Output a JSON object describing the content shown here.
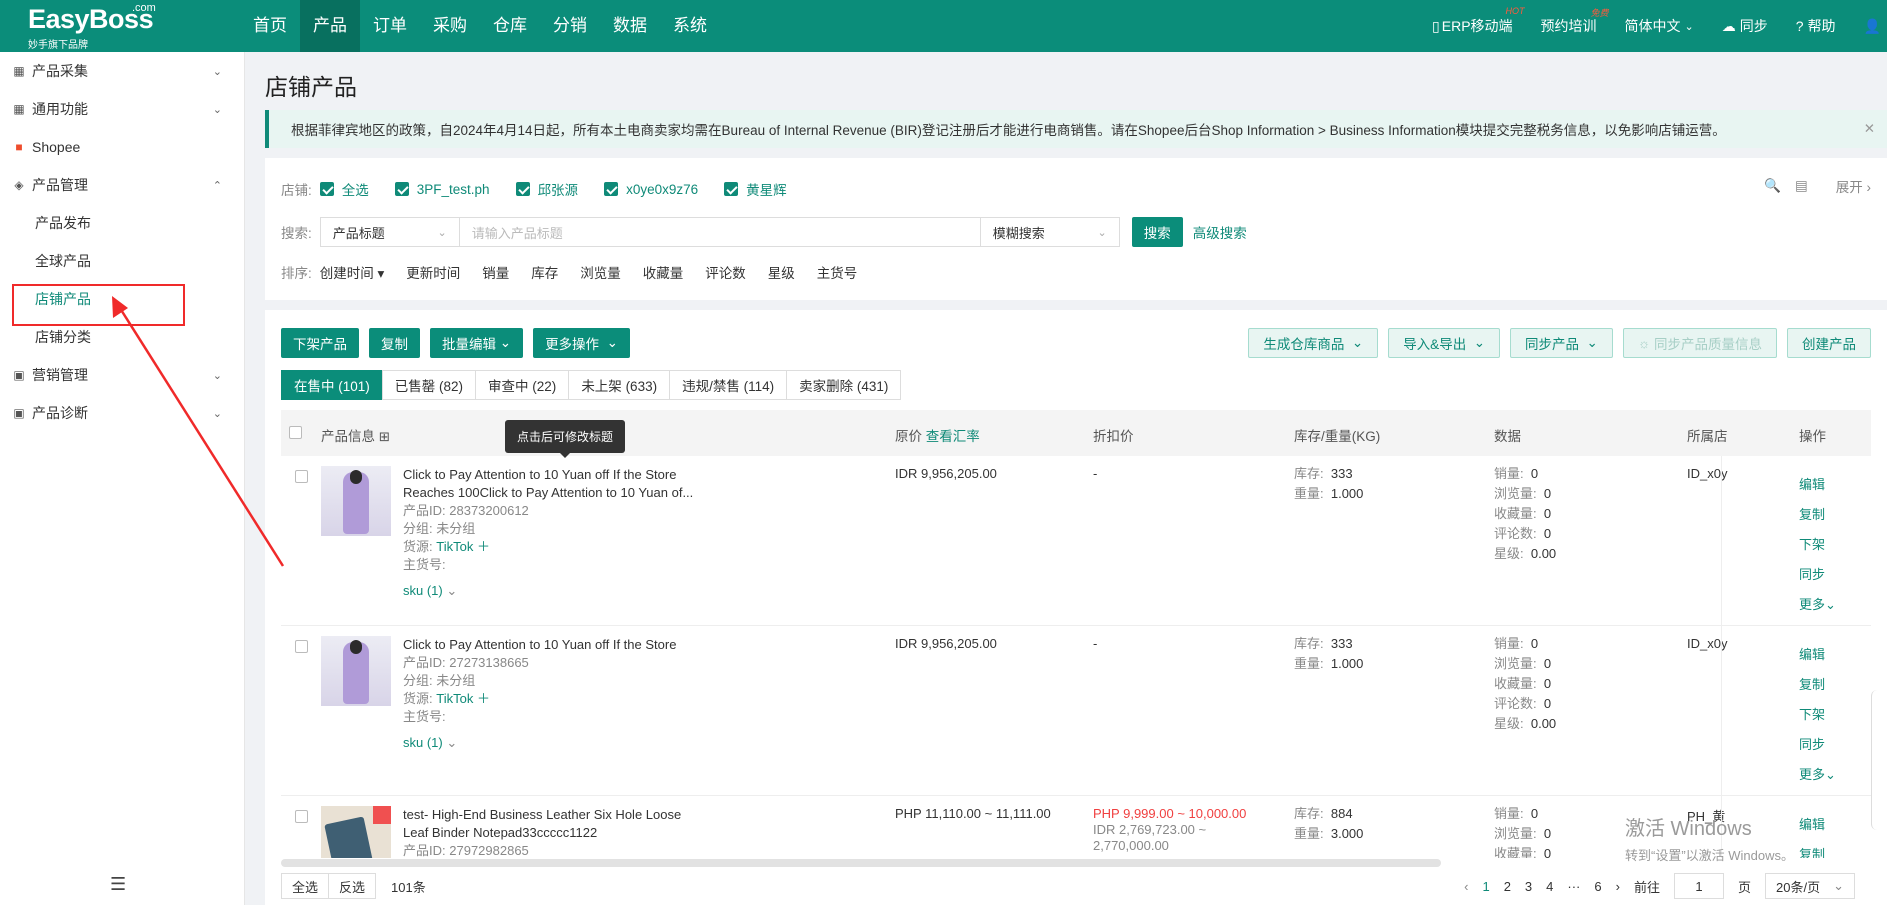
{
  "topbar": {
    "brand": "EasyBoss",
    "brand_suffix": ".com",
    "slogan": "妙手旗下品牌",
    "nav": [
      "首页",
      "产品",
      "订单",
      "采购",
      "仓库",
      "分销",
      "数据",
      "系统"
    ],
    "right": {
      "mobile": "ERP移动端",
      "mobile_badge": "HOT",
      "training": "预约培训",
      "training_badge": "免费",
      "language": "简体中文",
      "sync": "同步",
      "help": "帮助"
    }
  },
  "sidebar": {
    "groups": [
      {
        "label": "产品采集",
        "icon": "grid-icon"
      },
      {
        "label": "通用功能",
        "icon": "grid-icon"
      },
      {
        "label": "Shopee",
        "icon": "shopee-bag-icon"
      },
      {
        "label": "产品管理",
        "icon": "cube-icon"
      }
    ],
    "sub_items": [
      "产品发布",
      "全球产品",
      "店铺产品",
      "店铺分类"
    ],
    "active_sub": "店铺产品",
    "more_groups": [
      {
        "label": "营销管理",
        "icon": "megaphone-icon"
      },
      {
        "label": "产品诊断",
        "icon": "diagnosis-icon"
      }
    ]
  },
  "page": {
    "title": "店铺产品",
    "notice": "根据菲律宾地区的政策，自2024年4月14日起，所有本土电商卖家均需在Bureau of Internal Revenue (BIR)登记注册后才能进行电商销售。请在Shopee后台Shop Information > Business Information模块提交完整税务信息，以免影响店铺运营。"
  },
  "filter": {
    "shop_label": "店铺:",
    "shops": [
      "全选",
      "3PF_test.ph",
      "邱张源",
      "x0ye0x9z76",
      "黄星辉"
    ],
    "expand": "展开",
    "search_label": "搜索:",
    "search_field": "产品标题",
    "search_placeholder": "请输入产品标题",
    "match_mode": "模糊搜索",
    "search_btn": "搜索",
    "advanced": "高级搜索",
    "sort_label": "排序:",
    "sort_active": "创建时间",
    "sorts": [
      "更新时间",
      "销量",
      "库存",
      "浏览量",
      "收藏量",
      "评论数",
      "星级",
      "主货号"
    ]
  },
  "actions": {
    "left": [
      "下架产品",
      "复制",
      "批量编辑",
      "更多操作"
    ],
    "right": [
      "生成仓库商品",
      "导入&导出",
      "同步产品",
      "同步产品质量信息",
      "创建产品"
    ]
  },
  "tabs": [
    "在售中 (101)",
    "已售罄 (82)",
    "审查中 (22)",
    "未上架 (633)",
    "违规/禁售 (114)",
    "卖家删除 (431)"
  ],
  "table": {
    "headers": {
      "info": "产品信息",
      "price": "原价",
      "rate": "查看汇率",
      "discount": "折扣价",
      "stock": "库存/重量(KG)",
      "data": "数据",
      "store": "所属店",
      "op": "操作"
    },
    "tooltip": "点击后可修改标题",
    "labels": {
      "id": "产品ID:",
      "group": "分组:",
      "source": "货源:",
      "sku_no": "主货号:",
      "stock": "库存:",
      "weight": "重量:",
      "sales": "销量:",
      "views": "浏览量:",
      "favs": "收藏量:",
      "reviews": "评论数:",
      "stars": "星级:"
    },
    "ops": [
      "编辑",
      "复制",
      "下架",
      "同步",
      "更多"
    ],
    "rows": [
      {
        "title1": "Click to Pay Attention to 10 Yuan off If the Store",
        "title2": "Reaches 100Click to Pay Attention to 10 Yuan of...",
        "id": "28373200612",
        "group": "未分组",
        "source": "TikTok",
        "sku": "sku (1)",
        "price": "IDR 9,956,205.00",
        "discount": "-",
        "stock": "333",
        "weight": "1.000",
        "sales": "0",
        "views": "0",
        "favs": "0",
        "reviews": "0",
        "stars": "0.00",
        "store": "ID_x0y"
      },
      {
        "title1": "Click to Pay Attention to 10 Yuan off If the Store",
        "title2": "",
        "id": "27273138665",
        "group": "未分组",
        "source": "TikTok",
        "sku": "sku (1)",
        "price": "IDR 9,956,205.00",
        "discount": "-",
        "stock": "333",
        "weight": "1.000",
        "sales": "0",
        "views": "0",
        "favs": "0",
        "reviews": "0",
        "stars": "0.00",
        "store": "ID_x0y"
      },
      {
        "title1": "test- High-End Business Leather Six Hole Loose",
        "title2": "Leaf Binder Notepad33ccccc1122",
        "id": "27972982865",
        "price": "PHP 11,110.00 ~ 11,111.00",
        "discount": "PHP 9,999.00 ~ 10,000.00",
        "discount2a": "IDR 2,769,723.00 ~",
        "discount2b": "2,770,000.00",
        "stock": "884",
        "weight": "3.000",
        "sales": "0",
        "views": "0",
        "favs": "0",
        "store": "PH_黄"
      }
    ]
  },
  "footer": {
    "select_all": "全选",
    "invert": "反选",
    "count": "101条",
    "pages": [
      "1",
      "2",
      "3",
      "4",
      "6"
    ],
    "current_page": "1",
    "ellipsis": "···",
    "goto": "前往",
    "page_input": "1",
    "page_unit": "页",
    "page_size": "20条/页"
  },
  "watermark": {
    "line1": "激活 Windows",
    "line2": "转到“设置”以激活 Windows。"
  }
}
